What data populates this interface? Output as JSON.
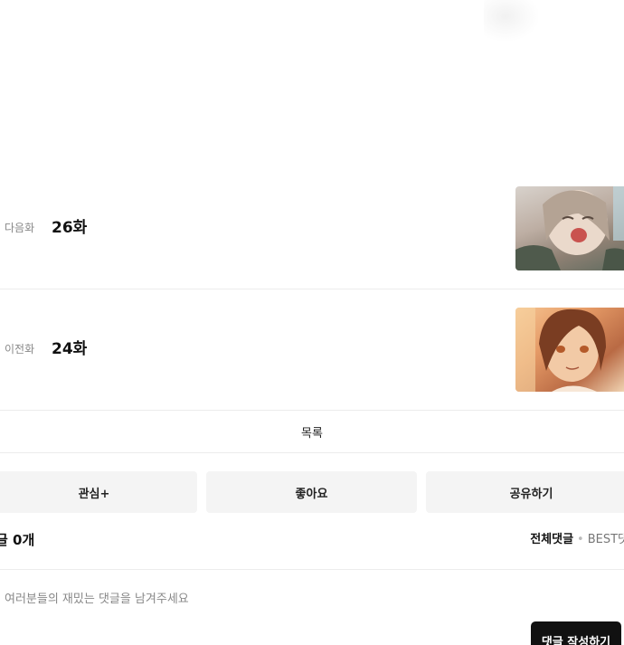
{
  "next_episode": {
    "kind": "다음화",
    "number": "26화"
  },
  "prev_episode": {
    "kind": "이전화",
    "number": "24화"
  },
  "list_label": "목록",
  "actions": {
    "follow": "관심+",
    "like": "좋아요",
    "share": "공유하기"
  },
  "comments": {
    "count_label": "글 0개",
    "tab_all": "전체댓글",
    "tab_separator": "•",
    "tab_best": "BEST댓",
    "placeholder": "여러분들의 재밌는 댓글을 남겨주세요",
    "write_button": "댓글 작성하기"
  }
}
